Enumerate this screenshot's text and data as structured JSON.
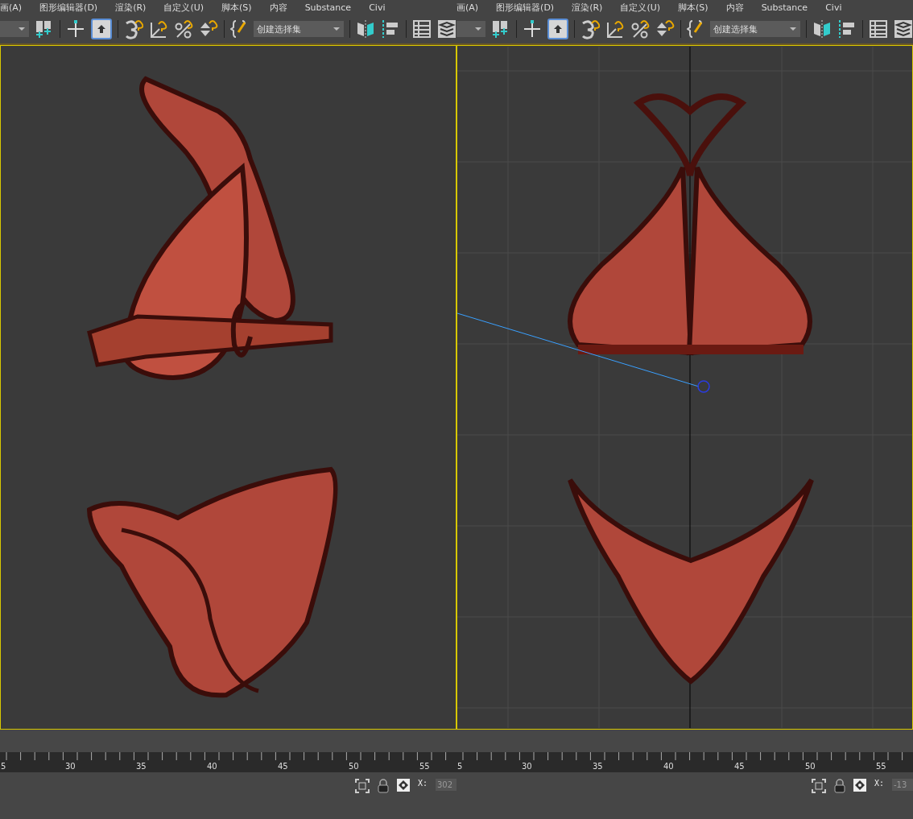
{
  "panes": [
    {
      "menu": [
        "画(A)",
        "图形编辑器(D)",
        "渲染(R)",
        "自定义(U)",
        "脚本(S)",
        "内容",
        "Substance",
        "Civi"
      ],
      "toolbar": {
        "select_tool": {
          "selected": true
        },
        "selection_set": {
          "value": "创建选择集"
        }
      },
      "viewport": {
        "kind": "perspective",
        "grid": false
      },
      "timeline": {
        "labels": [
          "5",
          "30",
          "35",
          "40",
          "45",
          "50",
          "55"
        ]
      },
      "status": {
        "x_label": "X:",
        "x_value": "302"
      }
    },
    {
      "menu": [
        "画(A)",
        "图形编辑器(D)",
        "渲染(R)",
        "自定义(U)",
        "脚本(S)",
        "内容",
        "Substance",
        "Civi"
      ],
      "toolbar": {
        "select_tool": {
          "selected": true
        },
        "selection_set": {
          "value": "创建选择集"
        }
      },
      "viewport": {
        "kind": "front",
        "grid": true
      },
      "timeline": {
        "labels": [
          "5",
          "30",
          "35",
          "40",
          "45",
          "50",
          "55"
        ]
      },
      "status": {
        "x_label": "X:",
        "x_value": "-13"
      }
    }
  ]
}
